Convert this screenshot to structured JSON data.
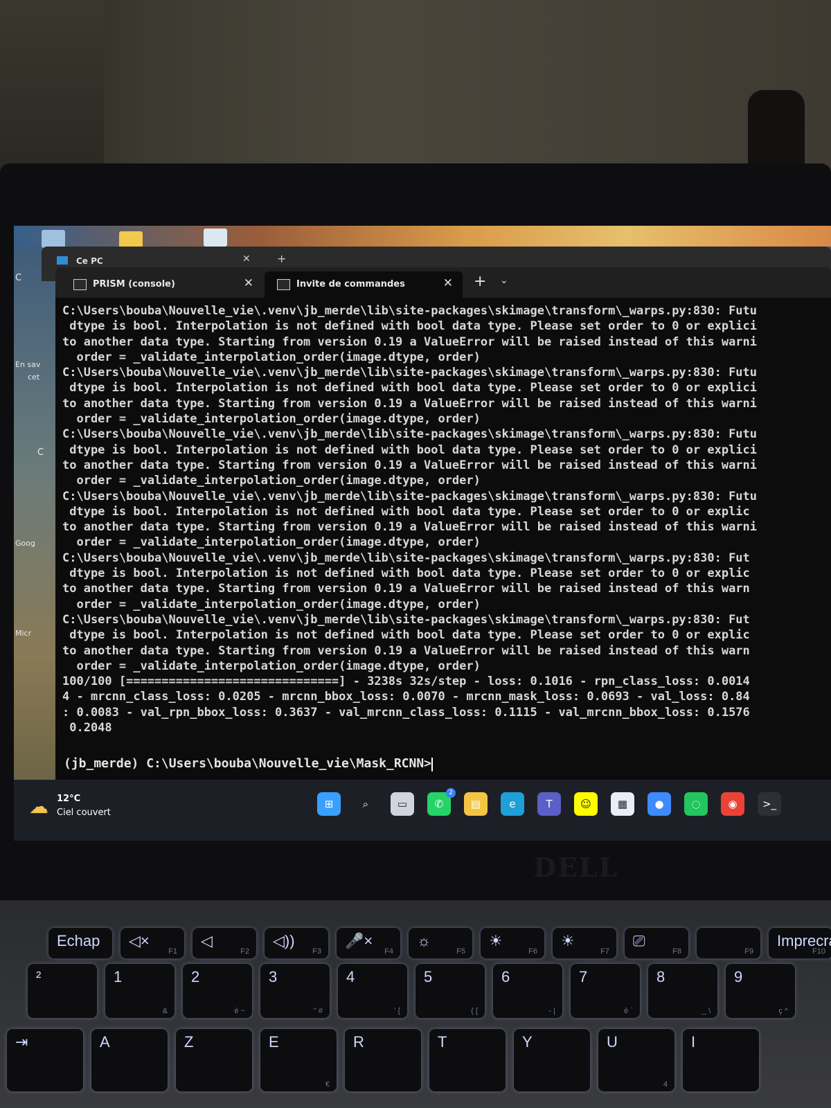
{
  "back_window": {
    "tab_label": "Ce PC"
  },
  "desktop": {
    "icon_texts": [
      "C",
      "En sav",
      "cet",
      "C",
      "Goog",
      "Micr"
    ]
  },
  "terminal": {
    "tabs": [
      {
        "label": "PRISM (console)"
      },
      {
        "label": "Invite de commandes"
      }
    ],
    "new_tab_symbol": "+",
    "close_symbol": "✕",
    "dropdown_symbol": "⌄",
    "output_lines": [
      "C:\\Users\\bouba\\Nouvelle_vie\\.venv\\jb_merde\\lib\\site-packages\\skimage\\transform\\_warps.py:830: Futu",
      " dtype is bool. Interpolation is not defined with bool data type. Please set order to 0 or explici",
      "to another data type. Starting from version 0.19 a ValueError will be raised instead of this warni",
      "  order = _validate_interpolation_order(image.dtype, order)",
      "C:\\Users\\bouba\\Nouvelle_vie\\.venv\\jb_merde\\lib\\site-packages\\skimage\\transform\\_warps.py:830: Futu",
      " dtype is bool. Interpolation is not defined with bool data type. Please set order to 0 or explici",
      "to another data type. Starting from version 0.19 a ValueError will be raised instead of this warni",
      "  order = _validate_interpolation_order(image.dtype, order)",
      "C:\\Users\\bouba\\Nouvelle_vie\\.venv\\jb_merde\\lib\\site-packages\\skimage\\transform\\_warps.py:830: Futu",
      " dtype is bool. Interpolation is not defined with bool data type. Please set order to 0 or explici",
      "to another data type. Starting from version 0.19 a ValueError will be raised instead of this warni",
      "  order = _validate_interpolation_order(image.dtype, order)",
      "C:\\Users\\bouba\\Nouvelle_vie\\.venv\\jb_merde\\lib\\site-packages\\skimage\\transform\\_warps.py:830: Futu",
      " dtype is bool. Interpolation is not defined with bool data type. Please set order to 0 or explic",
      "to another data type. Starting from version 0.19 a ValueError will be raised instead of this warni",
      "  order = _validate_interpolation_order(image.dtype, order)",
      "C:\\Users\\bouba\\Nouvelle_vie\\.venv\\jb_merde\\lib\\site-packages\\skimage\\transform\\_warps.py:830: Fut",
      " dtype is bool. Interpolation is not defined with bool data type. Please set order to 0 or explic",
      "to another data type. Starting from version 0.19 a ValueError will be raised instead of this warn",
      "  order = _validate_interpolation_order(image.dtype, order)",
      "C:\\Users\\bouba\\Nouvelle_vie\\.venv\\jb_merde\\lib\\site-packages\\skimage\\transform\\_warps.py:830: Fut",
      " dtype is bool. Interpolation is not defined with bool data type. Please set order to 0 or explic",
      "to another data type. Starting from version 0.19 a ValueError will be raised instead of this warn",
      "  order = _validate_interpolation_order(image.dtype, order)",
      "100/100 [==============================] - 3238s 32s/step - loss: 0.1016 - rpn_class_loss: 0.0014",
      "4 - mrcnn_class_loss: 0.0205 - mrcnn_bbox_loss: 0.0070 - mrcnn_mask_loss: 0.0693 - val_loss: 0.84",
      ": 0.0083 - val_rpn_bbox_loss: 0.3637 - val_mrcnn_class_loss: 0.1115 - val_mrcnn_bbox_loss: 0.1576",
      " 0.2048"
    ],
    "prompt": "(jb_merde) C:\\Users\\bouba\\Nouvelle_vie\\Mask_RCNN>"
  },
  "taskbar": {
    "weather_temp": "12°C",
    "weather_condition": "Ciel couvert",
    "whatsapp_badge": "2",
    "apps": [
      {
        "name": "start-button",
        "color": "#3aa0ff",
        "glyph": "⊞"
      },
      {
        "name": "search-button",
        "color": "transparent",
        "glyph": "⌕"
      },
      {
        "name": "task-view-button",
        "color": "#cfd4dd",
        "glyph": "▭"
      },
      {
        "name": "whatsapp-app",
        "color": "#25d366",
        "glyph": "✆"
      },
      {
        "name": "file-explorer-app",
        "color": "#f4c542",
        "glyph": "▤"
      },
      {
        "name": "edge-app",
        "color": "#1fa0d8",
        "glyph": "e"
      },
      {
        "name": "teams-app",
        "color": "#5b5fc7",
        "glyph": "T"
      },
      {
        "name": "snapchat-app",
        "color": "#fffc00",
        "glyph": "☺"
      },
      {
        "name": "store-app",
        "color": "#e8eef7",
        "glyph": "▦"
      },
      {
        "name": "people-app",
        "color": "#3d8bff",
        "glyph": "●"
      },
      {
        "name": "refresh-app",
        "color": "#22c55e",
        "glyph": "◌"
      },
      {
        "name": "chrome-app",
        "color": "#ea4335",
        "glyph": "◉"
      },
      {
        "name": "terminal-app",
        "color": "#2d2f36",
        "glyph": ">_"
      }
    ]
  },
  "keyboard": {
    "row1": [
      {
        "main": "Echap",
        "sub": ""
      },
      {
        "main": "◁×",
        "sub": "F1"
      },
      {
        "main": "◁",
        "sub": "F2"
      },
      {
        "main": "◁))",
        "sub": "F3"
      },
      {
        "main": "🎤×",
        "sub": "F4"
      },
      {
        "main": "☼",
        "sub": "F5"
      },
      {
        "main": "☀",
        "sub": "F6"
      },
      {
        "main": "☀",
        "sub": "F7"
      },
      {
        "main": "⎚",
        "sub": "F8"
      },
      {
        "main": "",
        "sub": "F9"
      },
      {
        "main": "Imprecran",
        "sub": "F10"
      }
    ],
    "row2": [
      {
        "main": "²",
        "sub": ""
      },
      {
        "main": "1",
        "sub": "&"
      },
      {
        "main": "2",
        "sub": "é ~"
      },
      {
        "main": "3",
        "sub": "\" #"
      },
      {
        "main": "4",
        "sub": "' {"
      },
      {
        "main": "5",
        "sub": "( ["
      },
      {
        "main": "6",
        "sub": "- |"
      },
      {
        "main": "7",
        "sub": "è `"
      },
      {
        "main": "8",
        "sub": "_ \\"
      },
      {
        "main": "9",
        "sub": "ç ^"
      }
    ],
    "row3": [
      {
        "main": "⇥",
        "sub": ""
      },
      {
        "main": "A",
        "sub": ""
      },
      {
        "main": "Z",
        "sub": ""
      },
      {
        "main": "E",
        "sub": "€"
      },
      {
        "main": "R",
        "sub": ""
      },
      {
        "main": "T",
        "sub": ""
      },
      {
        "main": "Y",
        "sub": ""
      },
      {
        "main": "U",
        "sub": "4"
      },
      {
        "main": "I",
        "sub": ""
      }
    ]
  },
  "bezel": {
    "brand": "DELL"
  }
}
